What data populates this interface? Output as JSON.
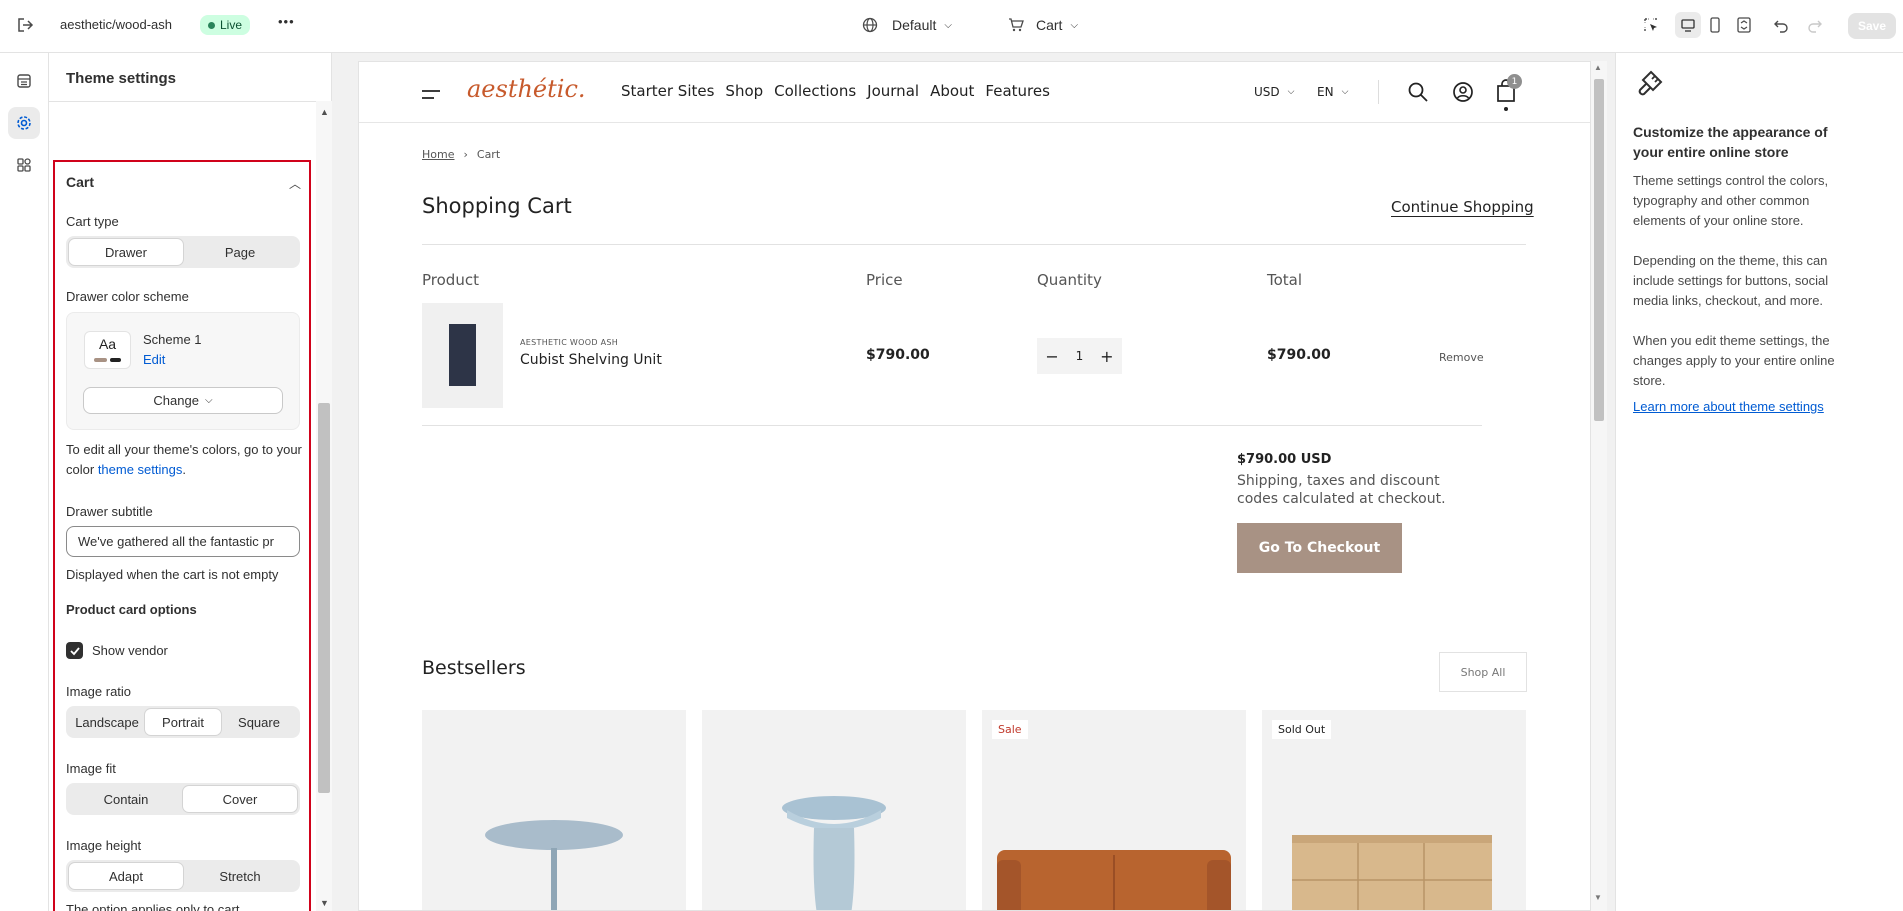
{
  "topbar": {
    "store_name": "aesthetic/wood-ash",
    "live_badge": "Live",
    "more": "•••",
    "theme_selector": "Default",
    "page_selector": "Cart",
    "save_label": "Save"
  },
  "settings": {
    "title": "Theme settings",
    "cart": {
      "heading": "Cart",
      "cart_type_label": "Cart type",
      "cart_type_options": [
        "Drawer",
        "Page"
      ],
      "cart_type_selected": "Drawer",
      "color_scheme_label": "Drawer color scheme",
      "scheme_preview": "Aa",
      "scheme_name": "Scheme 1",
      "scheme_edit": "Edit",
      "change_label": "Change",
      "help_text": "To edit all your theme's colors, go to your color",
      "help_link": "theme settings",
      "help_end": ".",
      "subtitle_label": "Drawer subtitle",
      "subtitle_value": "We've gathered all the fantastic pr",
      "subtitle_help": "Displayed when the cart is not empty",
      "product_card_options": "Product card options",
      "show_vendor_label": "Show vendor",
      "show_vendor_checked": true,
      "image_ratio_label": "Image ratio",
      "image_ratio_options": [
        "Landscape",
        "Portrait",
        "Square"
      ],
      "image_ratio_selected": "Portrait",
      "image_fit_label": "Image fit",
      "image_fit_options": [
        "Contain",
        "Cover"
      ],
      "image_fit_selected": "Cover",
      "image_height_label": "Image height",
      "image_height_options": [
        "Adapt",
        "Stretch"
      ],
      "image_height_selected": "Adapt",
      "image_height_help": "The option applies only to cart drawer"
    }
  },
  "store": {
    "logo": "aesthétic.",
    "nav": [
      "Starter Sites",
      "Shop",
      "Collections",
      "Journal",
      "About",
      "Features"
    ],
    "currency": "USD",
    "language": "EN",
    "cart_count": "1",
    "breadcrumb_home": "Home",
    "breadcrumb_sep": "›",
    "breadcrumb_current": "Cart",
    "page_title": "Shopping Cart",
    "continue_shopping": "Continue Shopping",
    "columns": [
      "Product",
      "Price",
      "Quantity",
      "Total"
    ],
    "item": {
      "vendor": "AESTHETIC WOOD ASH",
      "name": "Cubist Shelving Unit",
      "price": "$790.00",
      "qty": "1",
      "total": "$790.00",
      "remove": "Remove"
    },
    "subtotal": "$790.00 USD",
    "shipping_note": "Shipping, taxes and discount codes calculated at checkout.",
    "checkout": "Go To Checkout",
    "bestsellers": "Bestsellers",
    "shop_all": "Shop All",
    "badges": [
      "Sale",
      "Sold Out"
    ]
  },
  "help": {
    "heading": "Customize the appearance of your entire online store",
    "p1": "Theme settings control the colors, typography and other common elements of your online store.",
    "p2": "Depending on the theme, this can include settings for buttons, social media links, checkout, and more.",
    "p3": "When you edit theme settings, the changes apply to your entire online store.",
    "link": "Learn more about theme settings"
  },
  "colors": {
    "accent_link": "#005bd3",
    "logo": "#c75a2c",
    "checkout_bg": "#a89284",
    "highlight_border": "#d0021b",
    "live_badge_bg": "#cdfee1"
  }
}
